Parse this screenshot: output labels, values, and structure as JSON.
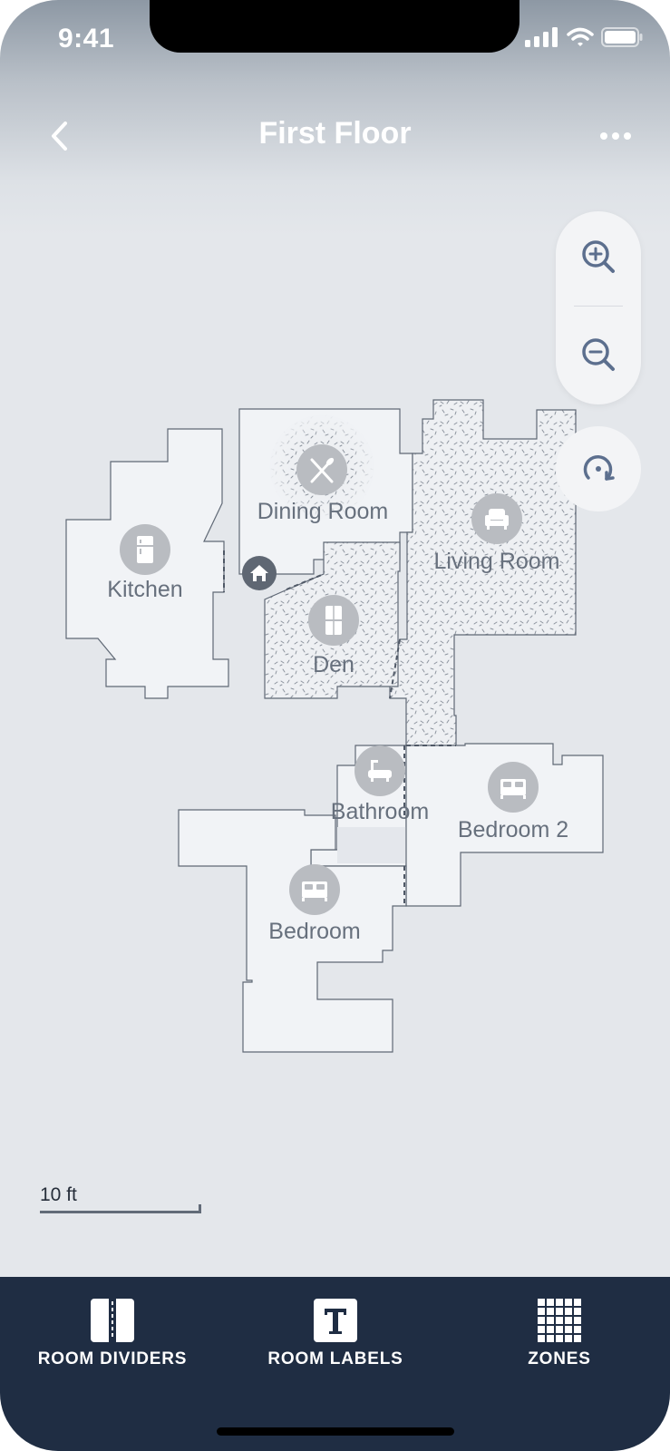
{
  "status_bar": {
    "time": "9:41"
  },
  "header": {
    "title": "First Floor"
  },
  "rooms": [
    {
      "name": "Kitchen",
      "icon": "refrigerator-icon"
    },
    {
      "name": "Dining Room",
      "icon": "fork-knife-icon"
    },
    {
      "name": "Living Room",
      "icon": "armchair-icon"
    },
    {
      "name": "Den",
      "icon": "cabinet-icon"
    },
    {
      "name": "Bathroom",
      "icon": "bathtub-icon"
    },
    {
      "name": "Bedroom 2",
      "icon": "bed-icon"
    },
    {
      "name": "Bedroom",
      "icon": "bed-icon"
    }
  ],
  "scale": {
    "label": "10 ft"
  },
  "toolbar": {
    "items": [
      {
        "label": "ROOM DIVIDERS",
        "icon": "room-dividers-icon"
      },
      {
        "label": "ROOM LABELS",
        "icon": "text-icon"
      },
      {
        "label": "ZONES",
        "icon": "grid-icon"
      }
    ]
  },
  "colors": {
    "floor": "#f1f3f6",
    "wall": "#5f6875",
    "icon_circle": "#b9bcc1",
    "room_text": "#67707d",
    "toolbar_bg": "#1f2d43"
  }
}
